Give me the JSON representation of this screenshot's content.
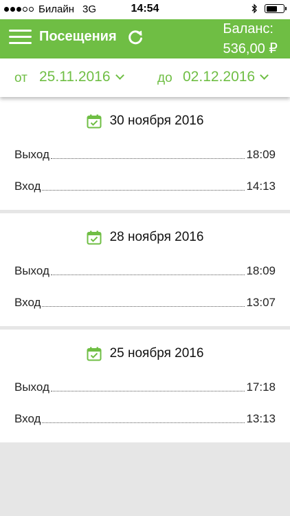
{
  "status_bar": {
    "carrier": "Билайн",
    "network": "3G",
    "time": "14:54"
  },
  "header": {
    "title": "Посещения",
    "balance_label": "Баланс:",
    "balance_value": "536,00 ₽"
  },
  "filter": {
    "from_label": "от",
    "from_date": "25.11.2016",
    "to_label": "до",
    "to_date": "02.12.2016"
  },
  "visits": [
    {
      "date": "30 ноября 2016",
      "entries": [
        {
          "label": "Выход",
          "time": "18:09"
        },
        {
          "label": "Вход",
          "time": "14:13"
        }
      ]
    },
    {
      "date": "28 ноября 2016",
      "entries": [
        {
          "label": "Выход",
          "time": "18:09"
        },
        {
          "label": "Вход",
          "time": "13:07"
        }
      ]
    },
    {
      "date": "25 ноября 2016",
      "entries": [
        {
          "label": "Выход",
          "time": "17:18"
        },
        {
          "label": "Вход",
          "time": "13:13"
        }
      ]
    }
  ],
  "colors": {
    "accent": "#6fbe44",
    "background": "#e6e6e6"
  }
}
